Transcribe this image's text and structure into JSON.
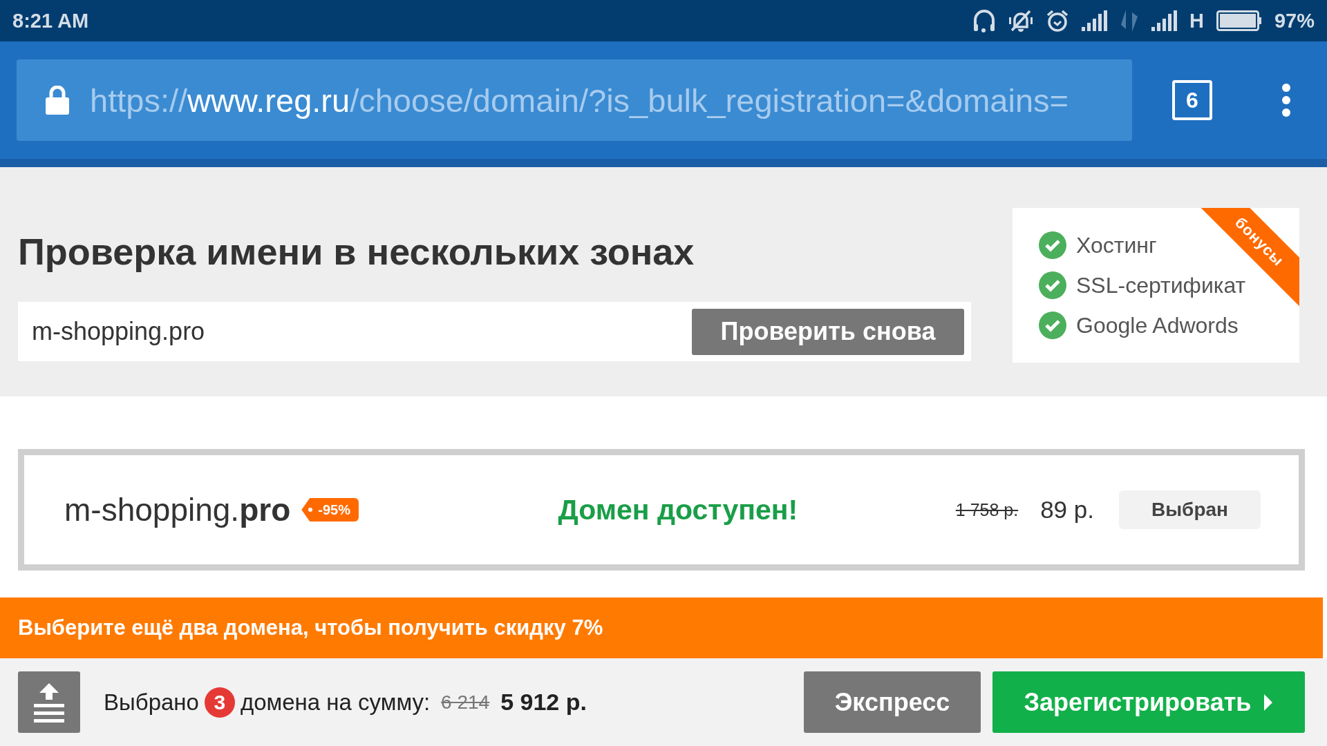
{
  "status_bar": {
    "time": "8:21 AM",
    "network": "H",
    "battery": "97%"
  },
  "browser": {
    "url_parts": [
      {
        "text": "https://",
        "kind": "dim"
      },
      {
        "text": "www.reg.ru",
        "kind": "host"
      },
      {
        "text": "/choose/domain/?is_bulk_registration=&domains=",
        "kind": "dim"
      }
    ],
    "tab_count": "6"
  },
  "search": {
    "title": "Проверка имени в нескольких зонах",
    "value": "m-shopping.pro",
    "button": "Проверить снова"
  },
  "bonus": {
    "ribbon": "бонусы",
    "items": [
      "Хостинг",
      "SSL-сертификат",
      "Google Adwords"
    ]
  },
  "result": {
    "domain": "m-shopping.**pro**",
    "discount": "-95%",
    "status": "Домен доступен!",
    "old_price": "1 758 р.",
    "price": "89 р.",
    "button": "Выбран"
  },
  "promo": {
    "text": "Выберите ещё два домена, чтобы получить скидку 7%"
  },
  "cart": {
    "label": "Выбрано",
    "count": "3",
    "label_2": "домена на сумму:",
    "old_total": "6 214",
    "total": "5 912 р.",
    "buttons": [
      {
        "label": "Экспресс",
        "kind": "secondary"
      },
      {
        "label": "Зарегистрировать",
        "kind": "primary"
      }
    ]
  }
}
